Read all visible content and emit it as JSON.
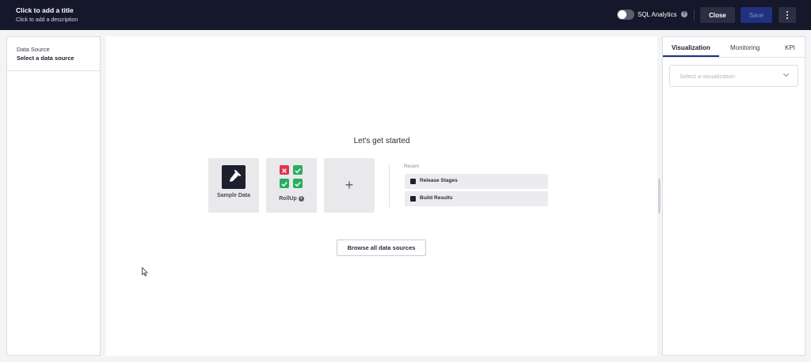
{
  "header": {
    "title": "Click to add a title",
    "description": "Click to add a description",
    "sql_toggle_label": "SQL Analytics",
    "help_glyph": "?",
    "close_label": "Close",
    "save_label": "Save"
  },
  "left_panel": {
    "label": "Data Source",
    "value": "Select a data source"
  },
  "main": {
    "heading": "Let's get started",
    "tiles": [
      {
        "label": "Sample Data",
        "icon": "flask-icon"
      },
      {
        "label": "RollUp",
        "icon": "rollup-icon"
      },
      {
        "label": "+",
        "icon": "plus-icon"
      }
    ],
    "rollup_info_glyph": "i",
    "recent_label": "Recent",
    "recent_items": [
      {
        "label": "Release Stages"
      },
      {
        "label": "Build Results"
      }
    ],
    "browse_label": "Browse all data sources"
  },
  "right_panel": {
    "tabs": [
      "Visualization",
      "Monitoring",
      "KPI"
    ],
    "active_tab": "Visualization",
    "select_placeholder": "Select a visualization"
  },
  "colors": {
    "header_bg": "#15172b",
    "accent": "#1f3180",
    "status_red": "#e0344b",
    "status_green": "#27ae60"
  }
}
